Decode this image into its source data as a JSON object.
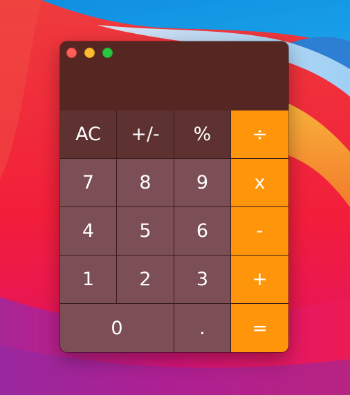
{
  "colors": {
    "window_background": "#552722",
    "function_key": "#5d3231",
    "number_key": "#7c4e55",
    "operator_key": "#fe950a",
    "key_text": "#ffffff",
    "traffic_close": "#fe5f57",
    "traffic_minimize": "#febc2e",
    "traffic_maximize": "#28c840"
  },
  "window": {
    "controls": [
      "close",
      "minimize",
      "maximize"
    ],
    "display_value": ""
  },
  "keys": {
    "ac": "AC",
    "sign": "+/-",
    "percent": "%",
    "divide": "÷",
    "seven": "7",
    "eight": "8",
    "nine": "9",
    "multiply": "x",
    "four": "4",
    "five": "5",
    "six": "6",
    "subtract": "-",
    "one": "1",
    "two": "2",
    "three": "3",
    "add": "+",
    "zero": "0",
    "decimal": ".",
    "equals": "="
  }
}
